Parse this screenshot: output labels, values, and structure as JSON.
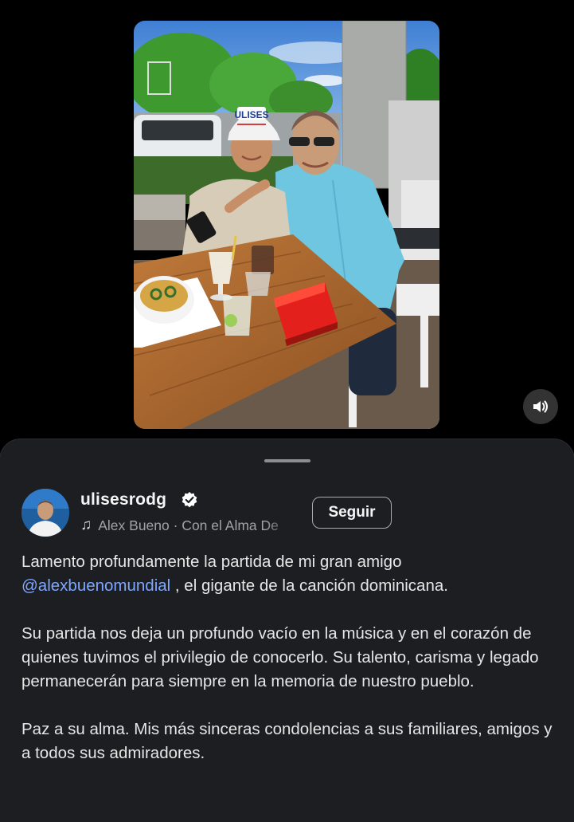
{
  "post": {
    "username": "ulisesrodg",
    "verified": true,
    "music_text": "Alex Bueno · Con el Alma De",
    "follow_label": "Seguir",
    "mute_icon": "speaker-icon"
  },
  "caption": {
    "p1_before": "Lamento profundamente la partida de mi gran amigo",
    "p1_mention": "@alexbuenomundial",
    "p1_after": " , el gigante de la canción dominicana.",
    "p2": "Su partida nos deja un profundo vacío en la música y en el corazón de quienes tuvimos el privilegio de conocerlo. Su talento, carisma y legado permanecerán para siempre en la memoria de nuestro pueblo.",
    "p3": "Paz a su alma. Mis más sinceras condolencias a sus familiares, amigos y a todos sus admiradores."
  },
  "photo": {
    "cap_text": "ULISES"
  },
  "colors": {
    "sheet_bg": "#1c1e21",
    "mention": "#7ea7ff",
    "verified_badge": "#ffffff"
  }
}
